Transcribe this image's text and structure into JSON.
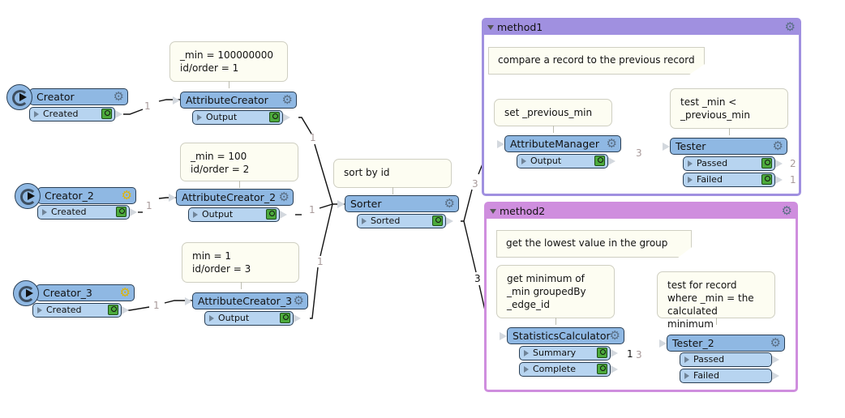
{
  "transformers": {
    "creator": {
      "name": "Creator",
      "port": "Created"
    },
    "creator_2": {
      "name": "Creator_2",
      "port": "Created"
    },
    "creator_3": {
      "name": "Creator_3",
      "port": "Created"
    },
    "attributecreator": {
      "name": "AttributeCreator",
      "port": "Output"
    },
    "attributecreator_2": {
      "name": "AttributeCreator_2",
      "port": "Output"
    },
    "attributecreator_3": {
      "name": "AttributeCreator_3",
      "port": "Output"
    },
    "sorter": {
      "name": "Sorter",
      "port": "Sorted"
    },
    "attributemanager": {
      "name": "AttributeManager",
      "port": "Output"
    },
    "tester": {
      "name": "Tester",
      "ports": [
        "Passed",
        "Failed"
      ]
    },
    "statisticscalculator": {
      "name": "StatisticsCalculator",
      "ports": [
        "Summary",
        "Complete"
      ]
    },
    "tester_2": {
      "name": "Tester_2",
      "ports": [
        "Passed",
        "Failed"
      ]
    }
  },
  "annotations": {
    "attributecreator": "_min = 100000000\nid/order = 1",
    "attributecreator_2": "_min = 100\nid/order = 2",
    "attributecreator_3": "min = 1\nid/order = 3",
    "sorter": "sort by id",
    "attributemanager": "set _previous_min",
    "tester": "test _min <\n_previous_min",
    "statisticscalculator": "get minimum of\n_min groupedBy\n_edge_id",
    "tester_2": "test for record\nwhere _min = the\ncalculated minimum"
  },
  "bookmarks": {
    "method1": {
      "title": "method1",
      "note": "compare a record to the previous record",
      "color": "#a090e0"
    },
    "method2": {
      "title": "method2",
      "note": "get the lowest value in the group",
      "color": "#cf8ede"
    }
  },
  "feature_counts": {
    "creator_out": "1",
    "creator_2_out": "1",
    "creator_3_out": "1",
    "ac_out": "1",
    "ac2_out": "1",
    "ac3_out": "1",
    "sorter_to_method1": "3",
    "sorter_to_method2": "3",
    "am_out": "3",
    "tester_passed": "2",
    "tester_failed": "1",
    "summary": "1",
    "complete": "3"
  }
}
